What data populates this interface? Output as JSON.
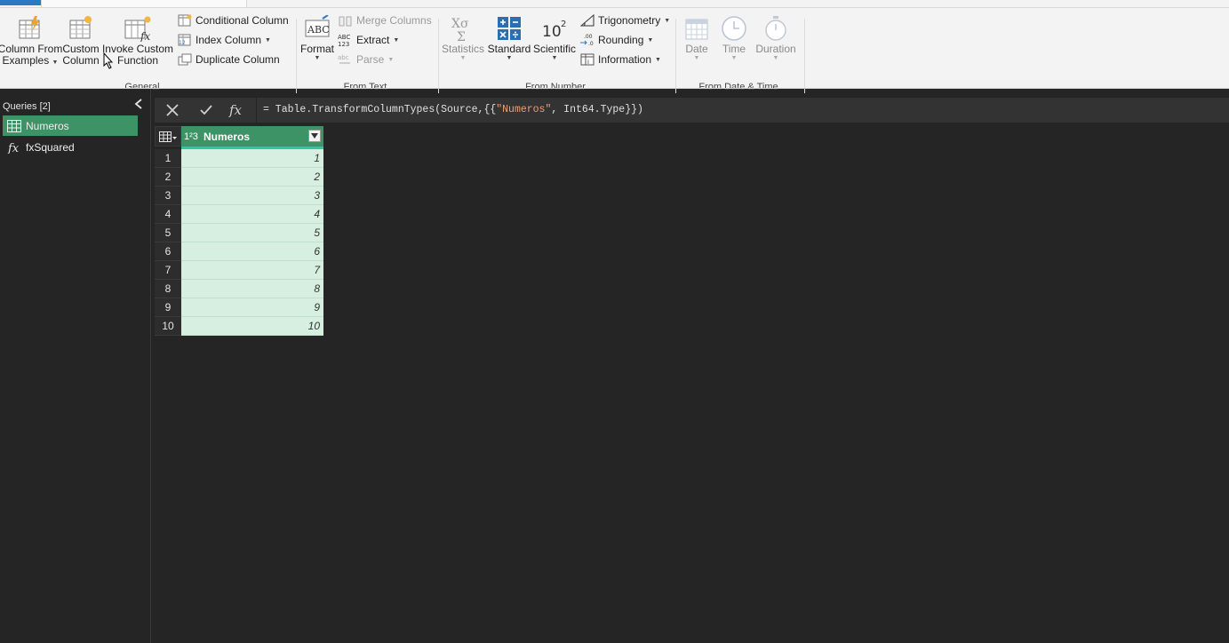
{
  "ribbon": {
    "general": {
      "group_label": "General",
      "column_from_examples": {
        "line1": "Column From",
        "line2": "Examples"
      },
      "custom_column": {
        "line1": "Custom",
        "line2": "Column"
      },
      "invoke_custom_function": {
        "line1": "Invoke Custom",
        "line2": "Function"
      },
      "conditional_column": "Conditional Column",
      "index_column": "Index Column",
      "duplicate_column": "Duplicate Column"
    },
    "from_text": {
      "group_label": "From Text",
      "format": "Format",
      "merge_columns": "Merge Columns",
      "extract": "Extract",
      "parse": "Parse"
    },
    "from_number": {
      "group_label": "From Number",
      "statistics": "Statistics",
      "standard": "Standard",
      "scientific": "Scientific",
      "trigonometry": "Trigonometry",
      "rounding": "Rounding",
      "information": "Information"
    },
    "from_datetime": {
      "group_label": "From Date & Time",
      "date": "Date",
      "time": "Time",
      "duration": "Duration"
    }
  },
  "queries": {
    "header": "Queries [2]",
    "items": [
      {
        "name": "Numeros",
        "icon": "table-icon",
        "selected": true
      },
      {
        "name": "fxSquared",
        "icon": "function-icon",
        "selected": false
      }
    ]
  },
  "formula_bar": {
    "prefix": "= Table.TransformColumnTypes(Source,{{",
    "string": "\"Numeros\"",
    "suffix": ", Int64.Type}})"
  },
  "table": {
    "column": {
      "name": "Numeros",
      "type_label": "1²3"
    },
    "rows": [
      "1",
      "2",
      "3",
      "4",
      "5",
      "6",
      "7",
      "8",
      "9",
      "10"
    ],
    "values": [
      "1",
      "2",
      "3",
      "4",
      "5",
      "6",
      "7",
      "8",
      "9",
      "10"
    ]
  },
  "colors": {
    "accent": "#3e9366",
    "cell_bg": "#d6efe1",
    "quality_bar": "#2bc9a3",
    "background": "#252525"
  }
}
